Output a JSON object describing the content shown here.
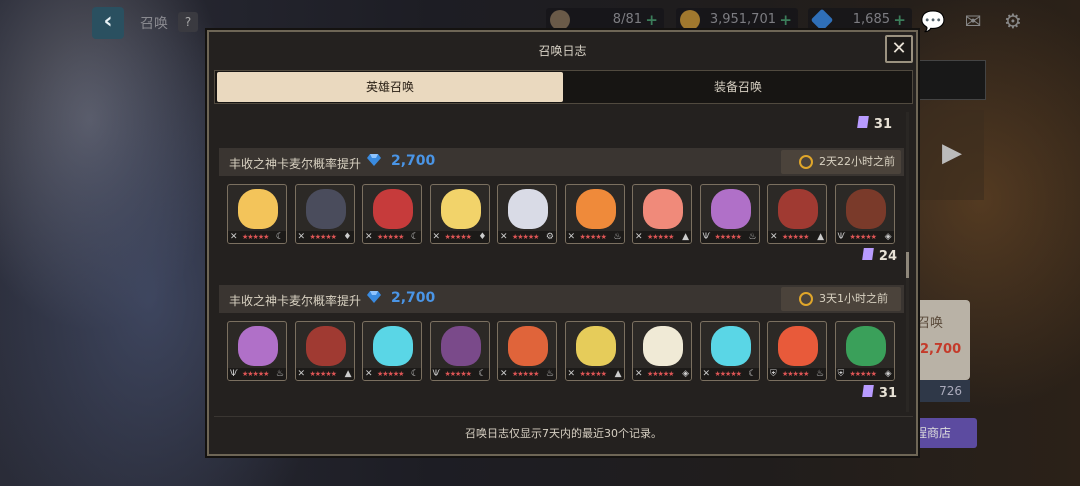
{
  "topbar": {
    "title": "召唤",
    "help": "?",
    "stamina": "8/81",
    "gold": "3,951,701",
    "gems": "1,685"
  },
  "right": {
    "summon_label": "召唤",
    "cost": "2,700",
    "count": "726",
    "shop": "程商店"
  },
  "modal": {
    "title": "召唤日志",
    "close": "✕",
    "tabs": [
      {
        "label": "英雄召唤",
        "active": true
      },
      {
        "label": "装备召唤",
        "active": false
      }
    ],
    "top_shards": "31",
    "records": [
      {
        "title": "丰收之神卡麦尔概率提升",
        "cost": "2,700",
        "time": "2天22小时之前",
        "shards": "24",
        "heroes": [
          {
            "face": "#f3c45a",
            "cls": "✕",
            "elem": "☾"
          },
          {
            "face": "#4a4c5c",
            "cls": "✕",
            "elem": "♦"
          },
          {
            "face": "#c63b3b",
            "cls": "✕",
            "elem": "☾"
          },
          {
            "face": "#f2d36a",
            "cls": "✕",
            "elem": "♦"
          },
          {
            "face": "#d9dbe6",
            "cls": "✕",
            "elem": "⚙"
          },
          {
            "face": "#ef8a3a",
            "cls": "✕",
            "elem": "♨"
          },
          {
            "face": "#f08a7a",
            "cls": "✕",
            "elem": "▲"
          },
          {
            "face": "#b070c8",
            "cls": "Ѱ",
            "elem": "♨"
          },
          {
            "face": "#a03a32",
            "cls": "✕",
            "elem": "▲"
          },
          {
            "face": "#7a3a2a",
            "cls": "Ѱ",
            "elem": "◈"
          }
        ]
      },
      {
        "title": "丰收之神卡麦尔概率提升",
        "cost": "2,700",
        "time": "3天1小时之前",
        "shards": "31",
        "heroes": [
          {
            "face": "#b070c8",
            "cls": "Ѱ",
            "elem": "♨"
          },
          {
            "face": "#a03a32",
            "cls": "✕",
            "elem": "▲"
          },
          {
            "face": "#5ad6e6",
            "cls": "✕",
            "elem": "☾"
          },
          {
            "face": "#7a4a8a",
            "cls": "Ѱ",
            "elem": "☾"
          },
          {
            "face": "#e0643a",
            "cls": "✕",
            "elem": "♨"
          },
          {
            "face": "#e6cc5a",
            "cls": "✕",
            "elem": "▲"
          },
          {
            "face": "#f0ead6",
            "cls": "✕",
            "elem": "◈"
          },
          {
            "face": "#5ad6e6",
            "cls": "✕",
            "elem": "☾"
          },
          {
            "face": "#e85a3a",
            "cls": "⛨",
            "elem": "♨"
          },
          {
            "face": "#3aa05a",
            "cls": "⛨",
            "elem": "◈"
          }
        ]
      }
    ],
    "footer": "召唤日志仅显示7天内的最近30个记录。"
  },
  "colors": {
    "accent_gem": "#4a95e6",
    "tab_active": "#ead9bf",
    "shard": "#b89bff"
  }
}
